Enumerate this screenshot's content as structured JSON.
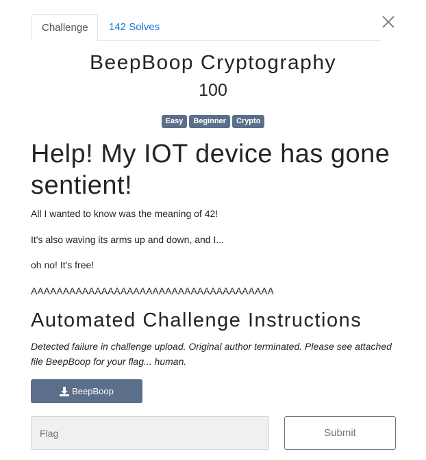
{
  "tabs": {
    "challenge_label": "Challenge",
    "solves_label": "142 Solves"
  },
  "close_icon": "close-icon",
  "challenge": {
    "name": "BeepBoop Cryptography",
    "points": "100",
    "tags": [
      "Easy",
      "Beginner",
      "Crypto"
    ]
  },
  "description": {
    "heading": "Help! My IOT device has gone sentient!",
    "paragraphs": [
      "All I wanted to know was the meaning of 42!",
      "It's also waving its arms up and down, and I...",
      "oh no! It's free!",
      "AAAAAAAAAAAAAAAAAAAAAAAAAAAAAAAAAAAAAA"
    ],
    "instructions_heading": "Automated Challenge Instructions",
    "instructions_text": "Detected failure in challenge upload. Original author terminated. Please see attached file BeepBoop for your flag... human."
  },
  "file": {
    "label": "BeepBoop",
    "icon": "download-icon"
  },
  "submission": {
    "placeholder": "Flag",
    "value": "",
    "submit_label": "Submit"
  },
  "colors": {
    "tag_bg": "#5b6f8b",
    "link": "#1a73d9",
    "input_bg": "#f0f0f0"
  }
}
